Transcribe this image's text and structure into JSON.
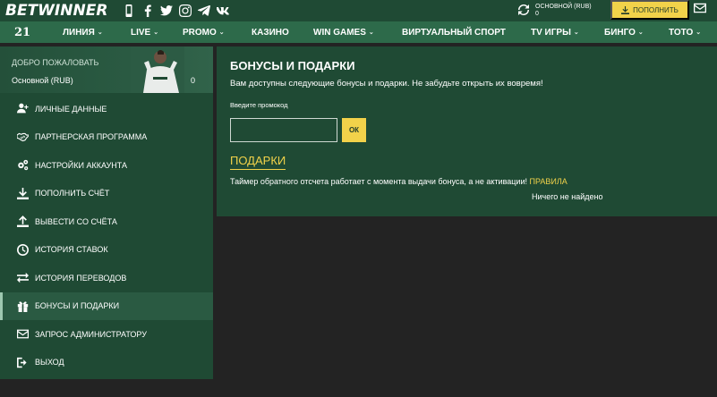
{
  "brand": {
    "bet": "BET",
    "winner": "WINNER"
  },
  "socials": [
    "mobile-icon",
    "facebook-icon",
    "twitter-icon",
    "instagram-icon",
    "telegram-icon",
    "vk-icon"
  ],
  "account": {
    "label": "ОСНОВНОЙ (RUB)",
    "balance": "0"
  },
  "deposit_label": "ПОПОЛНИТЬ",
  "nav": {
    "logo21": "21",
    "items": [
      {
        "label": "ЛИНИЯ",
        "has_menu": true
      },
      {
        "label": "LIVE",
        "has_menu": true
      },
      {
        "label": "PROMO",
        "has_menu": true
      },
      {
        "label": "КАЗИНО",
        "has_menu": false
      },
      {
        "label": "WIN GAMES",
        "has_menu": true
      },
      {
        "label": "ВИРТУАЛЬНЫЙ СПОРТ",
        "has_menu": false
      },
      {
        "label": "TV ИГРЫ",
        "has_menu": true
      },
      {
        "label": "БИНГО",
        "has_menu": true
      },
      {
        "label": "ТОТО",
        "has_menu": true
      }
    ]
  },
  "sidebar": {
    "welcome": "ДОБРО ПОЖАЛОВАТЬ",
    "account_name": "Основной (RUB)",
    "account_balance": "0",
    "items": [
      {
        "label": "ЛИЧНЫЕ ДАННЫЕ",
        "icon": "user-add-icon"
      },
      {
        "label": "ПАРТНЕРСКАЯ ПРОГРАММА",
        "icon": "handshake-icon"
      },
      {
        "label": "НАСТРОЙКИ АККАУНТА",
        "icon": "gears-icon"
      },
      {
        "label": "ПОПОЛНИТЬ СЧЁТ",
        "icon": "download-icon"
      },
      {
        "label": "ВЫВЕСТИ СО СЧЁТА",
        "icon": "upload-icon"
      },
      {
        "label": "ИСТОРИЯ СТАВОК",
        "icon": "clock-icon"
      },
      {
        "label": "ИСТОРИЯ ПЕРЕВОДОВ",
        "icon": "transfer-icon"
      },
      {
        "label": "БОНУСЫ И ПОДАРКИ",
        "icon": "gift-icon",
        "active": true
      },
      {
        "label": "ЗАПРОС АДМИНИСТРАТОРУ",
        "icon": "envelope-icon"
      },
      {
        "label": "ВЫХОД",
        "icon": "logout-icon"
      }
    ]
  },
  "main": {
    "title": "БОНУСЫ И ПОДАРКИ",
    "subtitle": "Вам доступны следующие бонусы и подарки. Не забудьте открыть их вовремя!",
    "promo_label": "Введите промокод",
    "promo_value": "",
    "ok_label": "ОК",
    "gifts_heading": "ПОДАРКИ",
    "timer_text": "Таймер обратного отсчета работает с момента выдачи бонуса, а не активации!",
    "rules_link": "ПРАВИЛА",
    "empty_text": "Ничего не найдено"
  },
  "colors": {
    "dark_green": "#1f4a34",
    "nav_green": "#2d6a4a",
    "accent_yellow": "#f2d24a",
    "background": "#232323"
  }
}
